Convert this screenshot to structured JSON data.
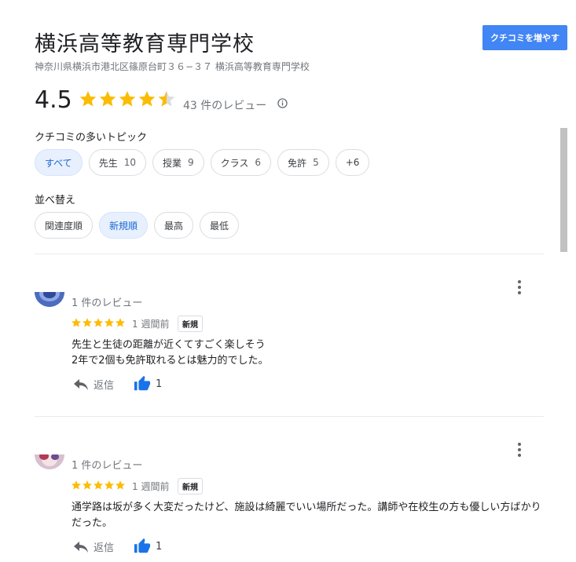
{
  "header": {
    "title": "横浜高等教育専門学校",
    "address": "神奈川県横浜市港北区篠原台町３６−３７ 横浜高等教育専門学校",
    "add_review_label": "クチコミを増やす"
  },
  "summary": {
    "rating": "4.5",
    "star_value": 4.5,
    "review_count": "43 件のレビュー",
    "info_icon": "info-icon"
  },
  "topics": {
    "label": "クチコミの多いトピック",
    "chips": [
      {
        "label": "すべて",
        "count": ""
      },
      {
        "label": "先生",
        "count": "10"
      },
      {
        "label": "授業",
        "count": "9"
      },
      {
        "label": "クラス",
        "count": "6"
      },
      {
        "label": "免許",
        "count": "5"
      },
      {
        "label": "+6",
        "count": ""
      }
    ]
  },
  "sort": {
    "label": "並べ替え",
    "options": [
      "関連度順",
      "新規順",
      "最高",
      "最低"
    ],
    "selected": "新規順"
  },
  "reviews": [
    {
      "reviewer_meta": "1 件のレビュー",
      "stars": 5,
      "time": "1 週間前",
      "badge": "新規",
      "text_lines": [
        "先生と生徒の距離が近くてすごく楽しそう",
        "2年で2個も免許取れるとは魅力的でした。"
      ],
      "reply_label": "返信",
      "likes": "1"
    },
    {
      "reviewer_meta": "1 件のレビュー",
      "stars": 5,
      "time": "1 週間前",
      "badge": "新規",
      "text_lines": [
        "通学路は坂が多く大変だったけど、施設は綺麗でいい場所だった。講師や在校生の方も優しい方ばかり",
        "だった。"
      ],
      "reply_label": "返信",
      "likes": "1"
    }
  ],
  "colors": {
    "accent": "#4285f4",
    "star": "#fbbc04",
    "chip_active_bg": "#e8f0fe",
    "chip_active_text": "#1967d2",
    "like_icon": "#1a73e8"
  }
}
